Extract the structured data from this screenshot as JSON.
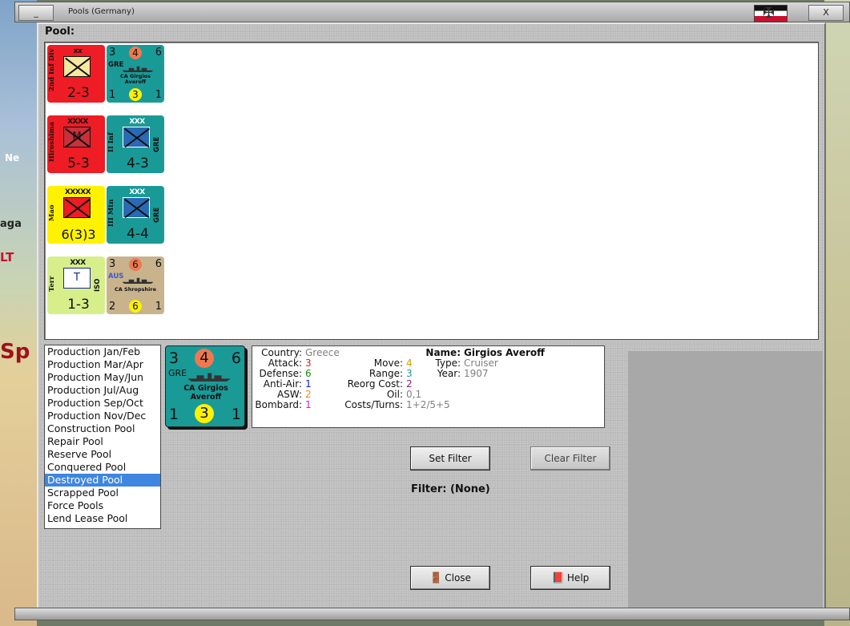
{
  "window": {
    "title": "Pools (Germany)",
    "minimize_label": "_",
    "close_label": "X"
  },
  "map": {
    "labels": [
      "Ne",
      "aga",
      "LT",
      "Sp"
    ]
  },
  "pool": {
    "label": "Pool:",
    "counters": [
      {
        "side": "2nd Inf Div",
        "size": "xx",
        "strength": "2-3",
        "color": "#ee1c24",
        "symbol": "infantry"
      },
      {
        "type": "ship",
        "top": [
          "3",
          "4",
          "6"
        ],
        "nation": "GRE",
        "name": "CA Girgios Averoff",
        "bottom": [
          "1",
          "3",
          "1"
        ]
      },
      {
        "side": "Hiroshima",
        "size": "XXXX",
        "mark": "M",
        "strength": "5-3",
        "color": "#ee1c24"
      },
      {
        "side": "II Inf",
        "side_right": "GRE",
        "size": "XXX",
        "strength": "4-3",
        "color": "#1a9a97"
      },
      {
        "side": "Mao",
        "size": "XXXXX",
        "strength": "6(3)3",
        "color": "#fff200"
      },
      {
        "side": "III Mtn",
        "side_right": "GRE",
        "size": "XXX",
        "strength": "4-4",
        "color": "#1a9a97"
      },
      {
        "side": "Terr",
        "side_right": "ISO",
        "size": "XXX",
        "mark": "T",
        "strength": "1-3",
        "color": "#d6ef8a"
      },
      {
        "type": "ship",
        "top": [
          "3",
          "6",
          "6"
        ],
        "nation": "AUS",
        "name": "CA Shropshire",
        "bottom": [
          "2",
          "6",
          "1"
        ]
      }
    ]
  },
  "pool_list": {
    "items": [
      "Production Jan/Feb",
      "Production Mar/Apr",
      "Production May/Jun",
      "Production Jul/Aug",
      "Production Sep/Oct",
      "Production Nov/Dec",
      "Construction Pool",
      "Repair Pool",
      "Reserve Pool",
      "Conquered Pool",
      "Destroyed Pool",
      "Scrapped Pool",
      "Force Pools",
      "Lend Lease Pool"
    ],
    "selected": "Destroyed Pool"
  },
  "selected_unit": {
    "top": [
      "3",
      "4",
      "6"
    ],
    "nation": "GRE",
    "name": "CA Girgios Averoff",
    "bottom": [
      "1",
      "3",
      "1"
    ],
    "country_label": "Country:",
    "country": "Greece",
    "attack_label": "Attack:",
    "attack": "3",
    "defense_label": "Defense:",
    "defense": "6",
    "antiair_label": "Anti-Air:",
    "antiair": "1",
    "asw_label": "ASW:",
    "asw": "2",
    "bombard_label": "Bombard:",
    "bombard": "1",
    "move_label": "Move:",
    "move": "4",
    "range_label": "Range:",
    "range": "3",
    "reorg_label": "Reorg Cost:",
    "reorg": "2",
    "oil_label": "Oil:",
    "oil": "0,1",
    "costs_label": "Costs/Turns:",
    "costs": "1+2/5+5",
    "name_label": "Name:",
    "name_value": "Girgios Averoff",
    "type_label": "Type:",
    "type": "Cruiser",
    "year_label": "Year:",
    "year": "1907"
  },
  "buttons": {
    "set_filter": "Set Filter",
    "clear_filter": "Clear Filter",
    "close": "Close",
    "help": "Help"
  },
  "filter_text": "Filter: (None)",
  "colors": {
    "attack": "#d4202a",
    "defense": "#1a8a1a",
    "antiair": "#1a1ad4",
    "asw": "#ee8a1a",
    "bombard": "#d41ad4",
    "move": "#c8a000",
    "range": "#1a9a97",
    "reorg": "#8a1a8a",
    "muted": "#808080",
    "selection": "#3e86e0"
  },
  "icons": {
    "flag": "german-flag-icon",
    "close": "door-exit-icon",
    "help": "book-icon"
  }
}
